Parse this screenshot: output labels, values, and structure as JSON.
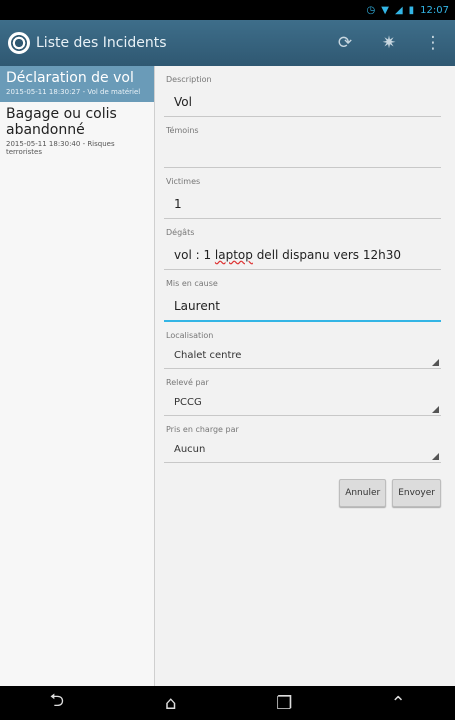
{
  "status": {
    "time": "12:07"
  },
  "actionbar": {
    "title": "Liste des Incidents",
    "icons": [
      "refresh-icon",
      "settings-icon",
      "overflow-menu-icon"
    ]
  },
  "incidents": [
    {
      "title": "Déclaration de vol",
      "subtitle": "2015-05-11 18:30:27 - Vol de matériel",
      "selected": true
    },
    {
      "title": "Bagage ou colis abandonné",
      "subtitle": "2015-05-11 18:30:40 - Risques terroristes",
      "selected": false
    }
  ],
  "form": {
    "description": {
      "label": "Description",
      "value": "Vol"
    },
    "temoins": {
      "label": "Témoins",
      "value": ""
    },
    "victimes": {
      "label": "Victimes",
      "value": "1"
    },
    "degats": {
      "label": "Dégâts",
      "value_prefix": "vol : 1 ",
      "value_flagged": "laptop",
      "value_suffix": " dell dispanu vers 12h30"
    },
    "mis_en_cause": {
      "label": "Mis en cause",
      "value": "Laurent"
    },
    "localisation": {
      "label": "Localisation",
      "value": "Chalet centre"
    },
    "releve_par": {
      "label": "Relevé par",
      "value": "PCCG"
    },
    "pris_en_charge": {
      "label": "Pris en charge par",
      "value": "Aucun"
    }
  },
  "buttons": {
    "cancel": "Annuler",
    "send": "Envoyer"
  }
}
